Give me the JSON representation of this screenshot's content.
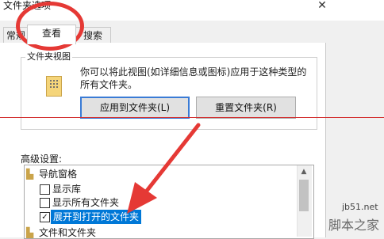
{
  "window": {
    "title": "文件夹选项",
    "close_glyph": "✕"
  },
  "tabs": [
    {
      "label": "常规",
      "shown": "常规",
      "selected": false
    },
    {
      "label": "查看",
      "shown": "查看",
      "selected": true
    },
    {
      "label": "搜索",
      "shown": "搜索",
      "selected": false
    }
  ],
  "folder_views": {
    "legend": "文件夹视图",
    "description": "你可以将此视图(如详细信息或图标)应用于这种类型的所有文件夹。",
    "apply_button": "应用到文件夹(L)",
    "reset_button": "重置文件夹(R)"
  },
  "advanced": {
    "label": "高级设置:",
    "items": [
      {
        "text": "导航窗格",
        "type": "folder"
      },
      {
        "text": "显示库",
        "type": "checkbox",
        "checked": false
      },
      {
        "text": "显示所有文件夹",
        "type": "checkbox",
        "checked": false
      },
      {
        "text": "展开到打开的文件夹",
        "type": "checkbox",
        "checked": true,
        "selected": true
      },
      {
        "text": "文件和文件夹",
        "type": "folder"
      }
    ]
  },
  "watermark": {
    "site": "jb51.net",
    "brand": "脚本之家"
  },
  "annotation_color": "#e53935"
}
